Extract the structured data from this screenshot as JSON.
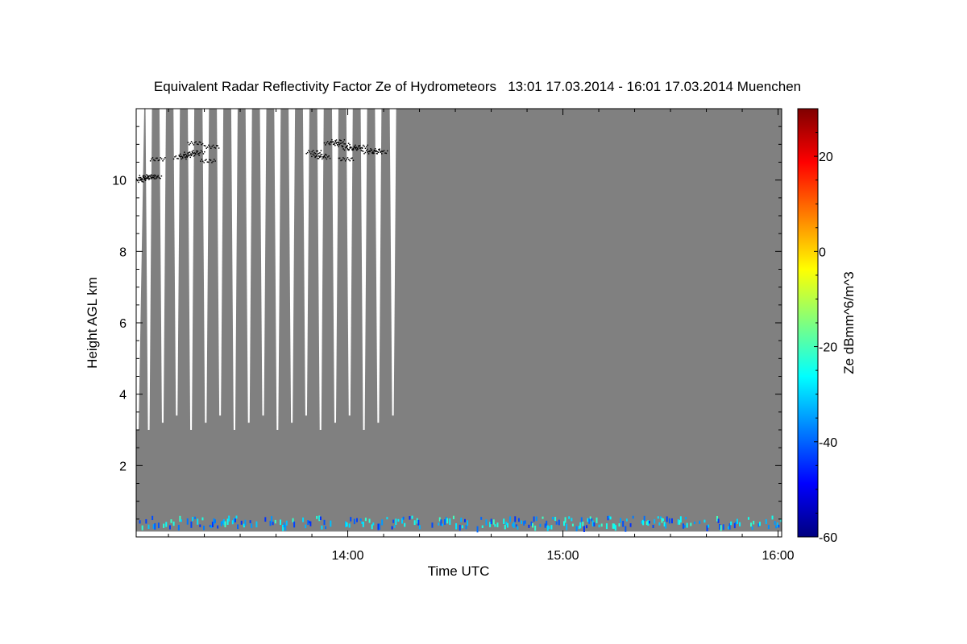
{
  "chart_data": {
    "type": "heatmap",
    "title": "Equivalent Radar Reflectivity Factor Ze of Hydrometeors   13:01 17.03.2014 - 16:01 17.03.2014 Muenchen",
    "xlabel": "Time UTC",
    "ylabel": "Height AGL km",
    "colorbar_label": "Ze dBmm^6/m^3",
    "x_range": [
      "13:01",
      "16:01"
    ],
    "xlim_minutes": [
      781,
      961
    ],
    "ylim": [
      0,
      12
    ],
    "x_ticks": [
      "14:00",
      "15:00",
      "16:00"
    ],
    "y_ticks": [
      2,
      4,
      6,
      8,
      10
    ],
    "colorbar_ticks": [
      20,
      0,
      -20,
      -40,
      -60
    ],
    "colorbar_range": [
      -60,
      30
    ],
    "colormap": "jet",
    "background_color": "#808080",
    "scan_gap_times_minutes": [
      784.5,
      788.4,
      792.3,
      796.3,
      800.4,
      804.4,
      808.4,
      812.4,
      816.4,
      820.4,
      824.4,
      828.4,
      832.4,
      836.5,
      840.5,
      844.5,
      848.5,
      852.6
    ],
    "cirrus_layer": [
      {
        "t": 781.5,
        "h": 10.0
      },
      {
        "t": 782.5,
        "h": 10.05
      },
      {
        "t": 784.0,
        "h": 10.1
      },
      {
        "t": 785.0,
        "h": 10.12
      },
      {
        "t": 786.0,
        "h": 10.1
      },
      {
        "t": 787.0,
        "h": 10.6
      },
      {
        "t": 793.5,
        "h": 10.65
      },
      {
        "t": 795.0,
        "h": 10.7
      },
      {
        "t": 796.5,
        "h": 10.75
      },
      {
        "t": 797.5,
        "h": 11.05
      },
      {
        "t": 798.0,
        "h": 10.8
      },
      {
        "t": 801.0,
        "h": 10.55
      },
      {
        "t": 802.0,
        "h": 10.95
      },
      {
        "t": 830.5,
        "h": 10.8
      },
      {
        "t": 832.0,
        "h": 10.7
      },
      {
        "t": 833.0,
        "h": 10.65
      },
      {
        "t": 835.5,
        "h": 11.05
      },
      {
        "t": 837.0,
        "h": 11.1
      },
      {
        "t": 838.5,
        "h": 11.0
      },
      {
        "t": 839.5,
        "h": 10.6
      },
      {
        "t": 840.5,
        "h": 10.9
      },
      {
        "t": 842.0,
        "h": 10.9
      },
      {
        "t": 843.5,
        "h": 10.95
      },
      {
        "t": 846.0,
        "h": 10.8
      },
      {
        "t": 847.5,
        "h": 10.85
      },
      {
        "t": 849.0,
        "h": 10.8
      }
    ],
    "low_echoes_height_range_km": [
      0.3,
      0.6
    ],
    "low_echoes_ze_range": [
      -45,
      -20
    ]
  }
}
